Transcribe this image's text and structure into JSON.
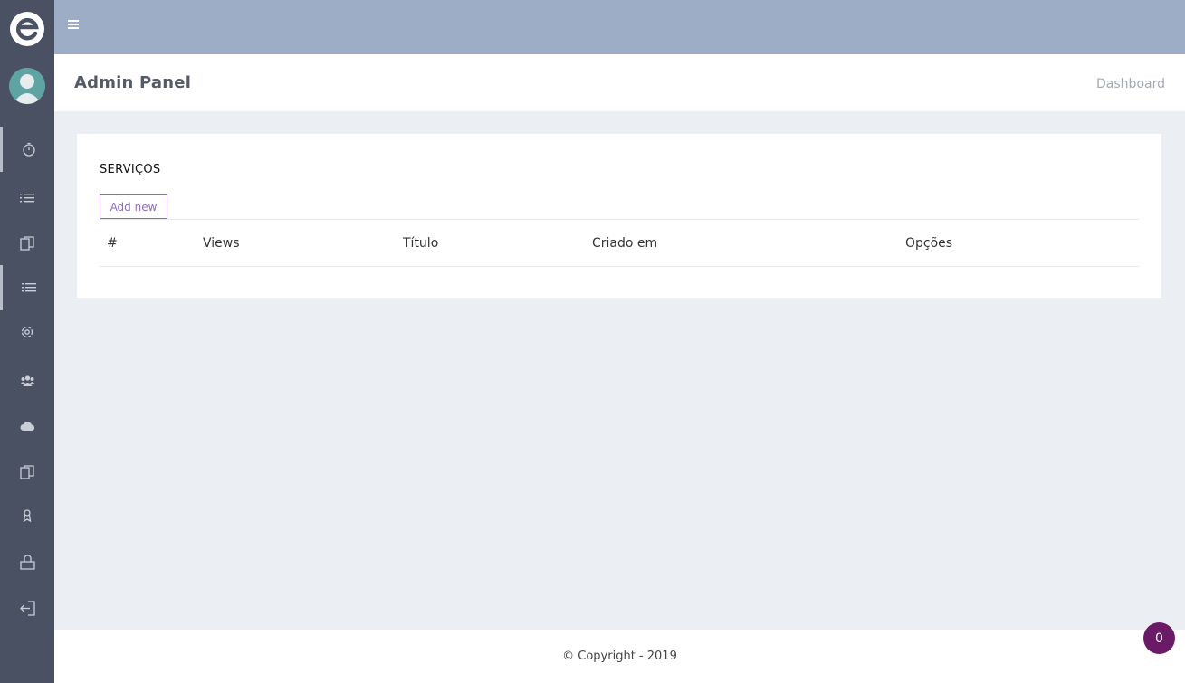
{
  "app": {
    "title": "Admin Panel",
    "breadcrumb": "Dashboard"
  },
  "sidebar": {
    "logo": "e-logo-icon",
    "avatar": "user-avatar",
    "items": [
      {
        "icon": "dashboard-clock-icon"
      },
      {
        "icon": "list-icon"
      },
      {
        "icon": "documents-icon"
      },
      {
        "icon": "list-icon"
      },
      {
        "icon": "settings-icon"
      },
      {
        "icon": "users-icon"
      },
      {
        "icon": "cloud-icon"
      },
      {
        "icon": "documents-icon"
      },
      {
        "icon": "badge-icon"
      },
      {
        "icon": "briefcase-icon"
      },
      {
        "icon": "logout-icon"
      }
    ]
  },
  "card": {
    "title": "SERVIÇOS",
    "add_button": "Add new",
    "columns": [
      "#",
      "Views",
      "Título",
      "Criado em",
      "Opções"
    ]
  },
  "footer": {
    "copyright": "© Copyright - 2019"
  },
  "notification": {
    "count": "0"
  },
  "colors": {
    "sidebar": "#4a5163",
    "topbar": "#9eadc6",
    "accent": "#8e6bbf",
    "badge": "#6a1a66",
    "background": "#ebeff4"
  }
}
